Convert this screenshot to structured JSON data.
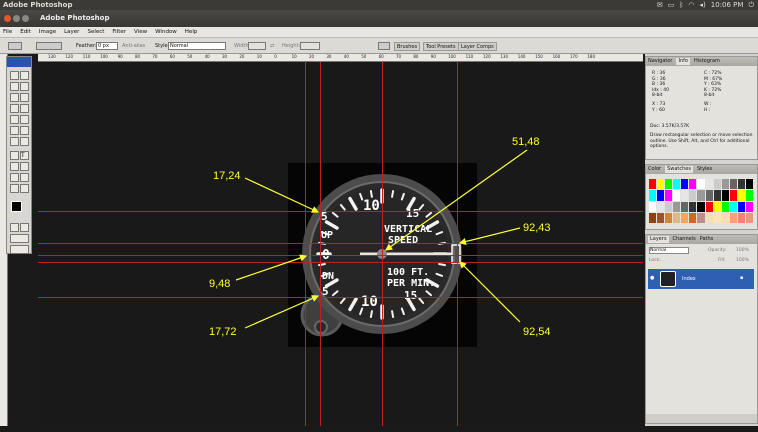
{
  "system_bar": {
    "title": "Adobe Photoshop",
    "time": "10:06 PM",
    "status_icons": [
      "mail-icon",
      "battery-icon",
      "bluetooth-icon",
      "wifi-icon",
      "volume-icon",
      "power-icon"
    ]
  },
  "window": {
    "title": "Adobe Photoshop"
  },
  "menu": [
    "File",
    "Edit",
    "Image",
    "Layer",
    "Select",
    "Filter",
    "View",
    "Window",
    "Help"
  ],
  "options": {
    "feather_label": "Feather:",
    "feather_value": "0 px",
    "antialias_label": "Anti-alias",
    "style_label": "Style:",
    "style_value": "Normal",
    "width_label": "Width:",
    "height_label": "Height:"
  },
  "palette_well": [
    "Brushes",
    "Tool Presets",
    "Layer Comps"
  ],
  "ruler_ticks": [
    "130",
    "120",
    "110",
    "100",
    "90",
    "80",
    "70",
    "60",
    "50",
    "40",
    "30",
    "20",
    "10",
    "0",
    "10",
    "20",
    "30",
    "40",
    "50",
    "60",
    "70",
    "80",
    "90",
    "100",
    "110",
    "120",
    "130",
    "140",
    "150",
    "160",
    "170",
    "180"
  ],
  "gauge": {
    "up_label": "UP",
    "dn_label": "DN",
    "five": "5",
    "ten": "10",
    "fifteen": "15",
    "zero": "0",
    "line1": "VERTICAL",
    "line2": "SPEED",
    "line3": "100 FT.",
    "line4": "PER MIN."
  },
  "annotations": [
    {
      "label": "17,24"
    },
    {
      "label": "51,48"
    },
    {
      "label": "92,43"
    },
    {
      "label": "9,48"
    },
    {
      "label": "17,72"
    },
    {
      "label": "92,54"
    }
  ],
  "info_panel": {
    "tabs": [
      "Navigator",
      "Info",
      "Histogram"
    ],
    "r": "R :",
    "r_val": "36",
    "g": "G :",
    "g_val": "36",
    "b": "B :",
    "b_val": "36",
    "idx": "Idx :",
    "idx_val": "40",
    "bit": "8-bit",
    "c": "C :",
    "c_val": "72%",
    "m": "M :",
    "m_val": "67%",
    "y": "Y :",
    "y_val": "63%",
    "k": "K :",
    "k_val": "72%",
    "x": "X :",
    "x_val": "73",
    "yy": "Y :",
    "yy_val": "60",
    "w": "W :",
    "h": "H :",
    "doc": "Doc: 3.57K/3.57K",
    "hint": "Draw rectangular selection or move selection outline.  Use Shift, Alt, and Ctrl for additional options."
  },
  "swatches_panel": {
    "tabs": [
      "Color",
      "Swatches",
      "Styles"
    ]
  },
  "layers_panel": {
    "tabs": [
      "Layers",
      "Channels",
      "Paths"
    ],
    "blend": "Normal",
    "opacity_label": "Opacity:",
    "opacity": "100%",
    "lock_label": "Lock:",
    "fill_label": "Fill:",
    "fill": "100%",
    "layer_name": "Index"
  },
  "colors": {
    "guide": "#c02020",
    "annotation": "#ffff33",
    "selection": "#2f5fb0"
  }
}
